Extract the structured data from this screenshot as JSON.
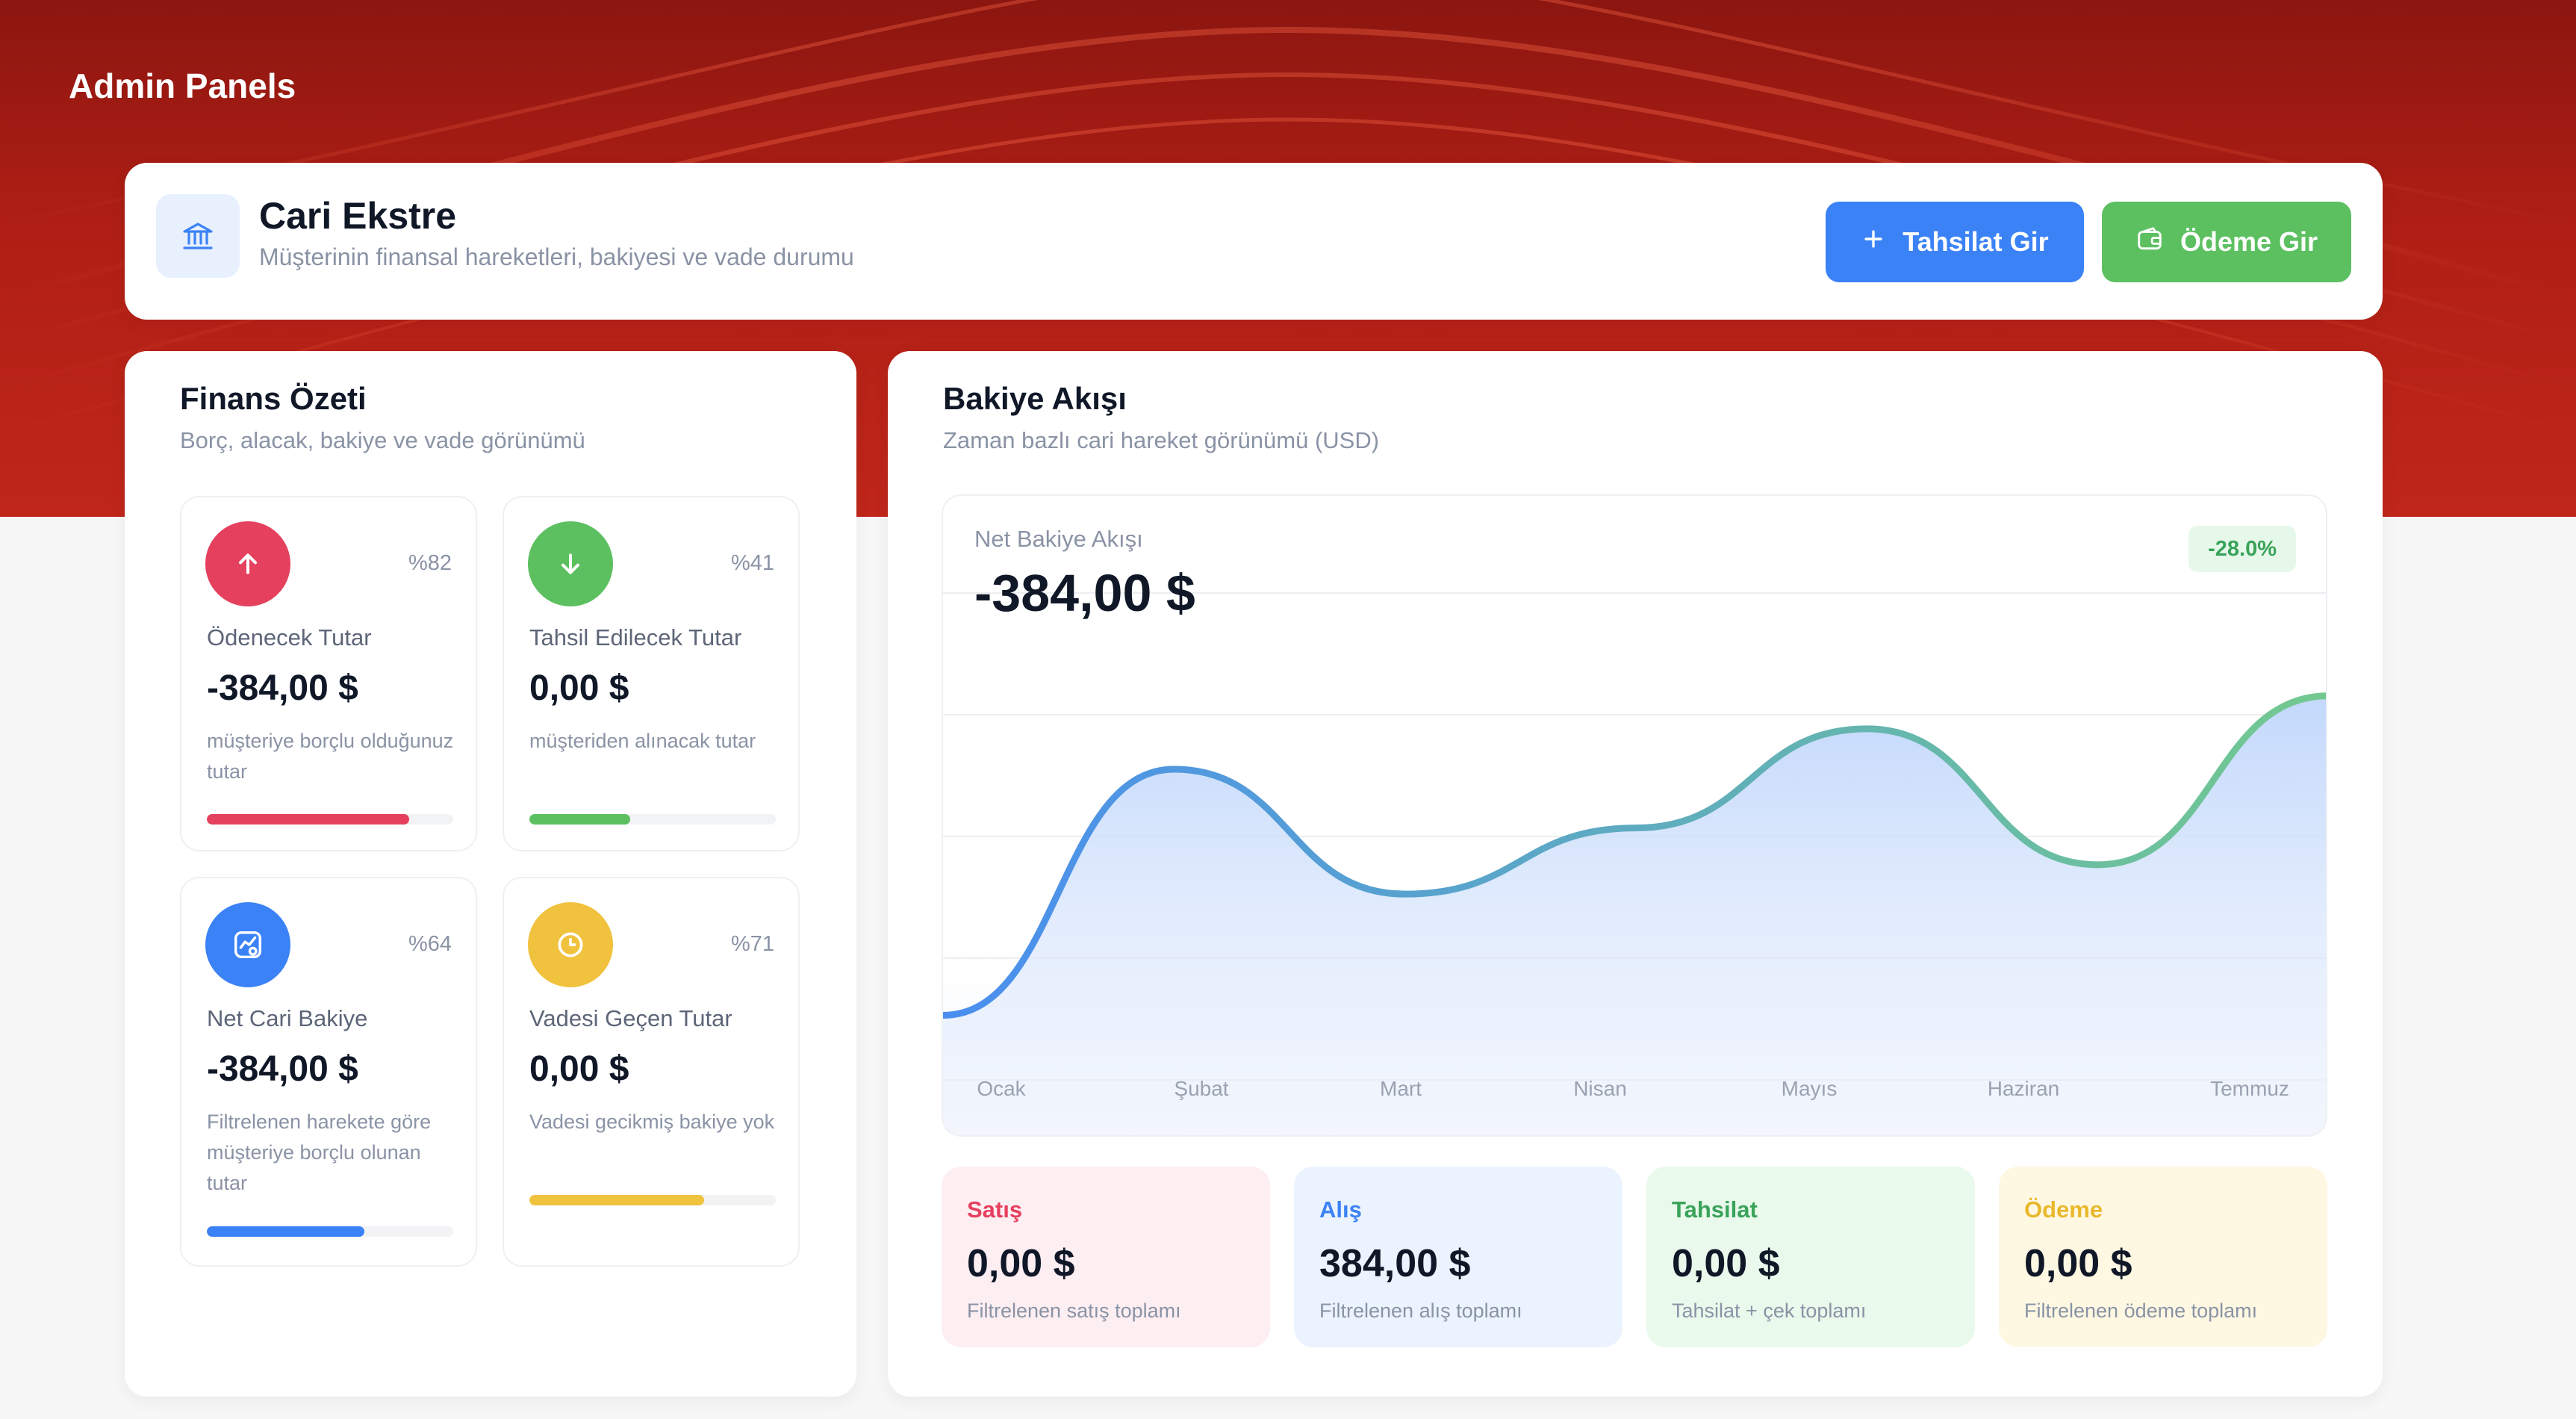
{
  "brand": "Admin Panels",
  "colors": {
    "hero_red": "#b01f15",
    "blue": "#3b82f6",
    "green": "#5cc060",
    "red": "#e5405e",
    "yellow": "#f0c23e"
  },
  "header": {
    "icon": "bank-icon",
    "title": "Cari Ekstre",
    "subtitle": "Müşterinin finansal hareketleri, bakiyesi ve vade durumu",
    "buttons": {
      "collect": {
        "label": "Tahsilat Gir",
        "icon": "plus-icon"
      },
      "pay": {
        "label": "Ödeme Gir",
        "icon": "wallet-icon"
      }
    }
  },
  "finance": {
    "title": "Finans Özeti",
    "subtitle": "Borç, alacak, bakiye ve vade görünümü",
    "stats": [
      {
        "icon": "arrow-up-icon",
        "percent": "%82",
        "progress": 0.82,
        "label": "Ödenecek Tutar",
        "value": "-384,00 $",
        "desc": "müşteriye borçlu olduğunuz tutar",
        "color": "#e5405e"
      },
      {
        "icon": "arrow-down-icon",
        "percent": "%41",
        "progress": 0.41,
        "label": "Tahsil Edilecek Tutar",
        "value": "0,00 $",
        "desc": "müşteriden alınacak tutar",
        "color": "#5cc060"
      },
      {
        "icon": "chart-badge-icon",
        "percent": "%64",
        "progress": 0.64,
        "label": "Net Cari Bakiye",
        "value": "-384,00 $",
        "desc": "Filtrelenen harekete göre müşteriye borçlu olunan tutar",
        "color": "#3b82f6"
      },
      {
        "icon": "clock-icon",
        "percent": "%71",
        "progress": 0.71,
        "label": "Vadesi Geçen Tutar",
        "value": "0,00 $",
        "desc": "Vadesi gecikmiş bakiye yok",
        "color": "#f0c23e"
      }
    ]
  },
  "flow": {
    "title": "Bakiye Akışı",
    "subtitle": "Zaman bazlı cari hareket görünümü (USD)",
    "chart_label": "Net Bakiye Akışı",
    "chart_value": "-384,00 $",
    "change_badge": "-28.0%",
    "summaries": [
      {
        "title": "Satış",
        "value": "0,00 $",
        "desc": "Filtrelenen satış toplamı",
        "color": "#e5405e",
        "bg": "#fdeef2"
      },
      {
        "title": "Alış",
        "value": "384,00 $",
        "desc": "Filtrelenen alış toplamı",
        "color": "#3b82f6",
        "bg": "#ebf3fe"
      },
      {
        "title": "Tahsilat",
        "value": "0,00 $",
        "desc": "Tahsilat + çek toplamı",
        "color": "#3aa35a",
        "bg": "#e9f9ec"
      },
      {
        "title": "Ödeme",
        "value": "0,00 $",
        "desc": "Filtrelenen ödeme toplamı",
        "color": "#e8b92c",
        "bg": "#fef8e3"
      }
    ]
  },
  "chart_data": {
    "type": "area",
    "categories": [
      "Ocak",
      "Şubat",
      "Mart",
      "Nisan",
      "Mayıs",
      "Haziran",
      "Temmuz"
    ],
    "values": [
      5,
      72,
      38,
      56,
      83,
      46,
      92
    ],
    "ylim": [
      0,
      120
    ],
    "grid": true,
    "legend": "none",
    "line_gradient": [
      "#4a8ef0",
      "#72c98f"
    ]
  }
}
